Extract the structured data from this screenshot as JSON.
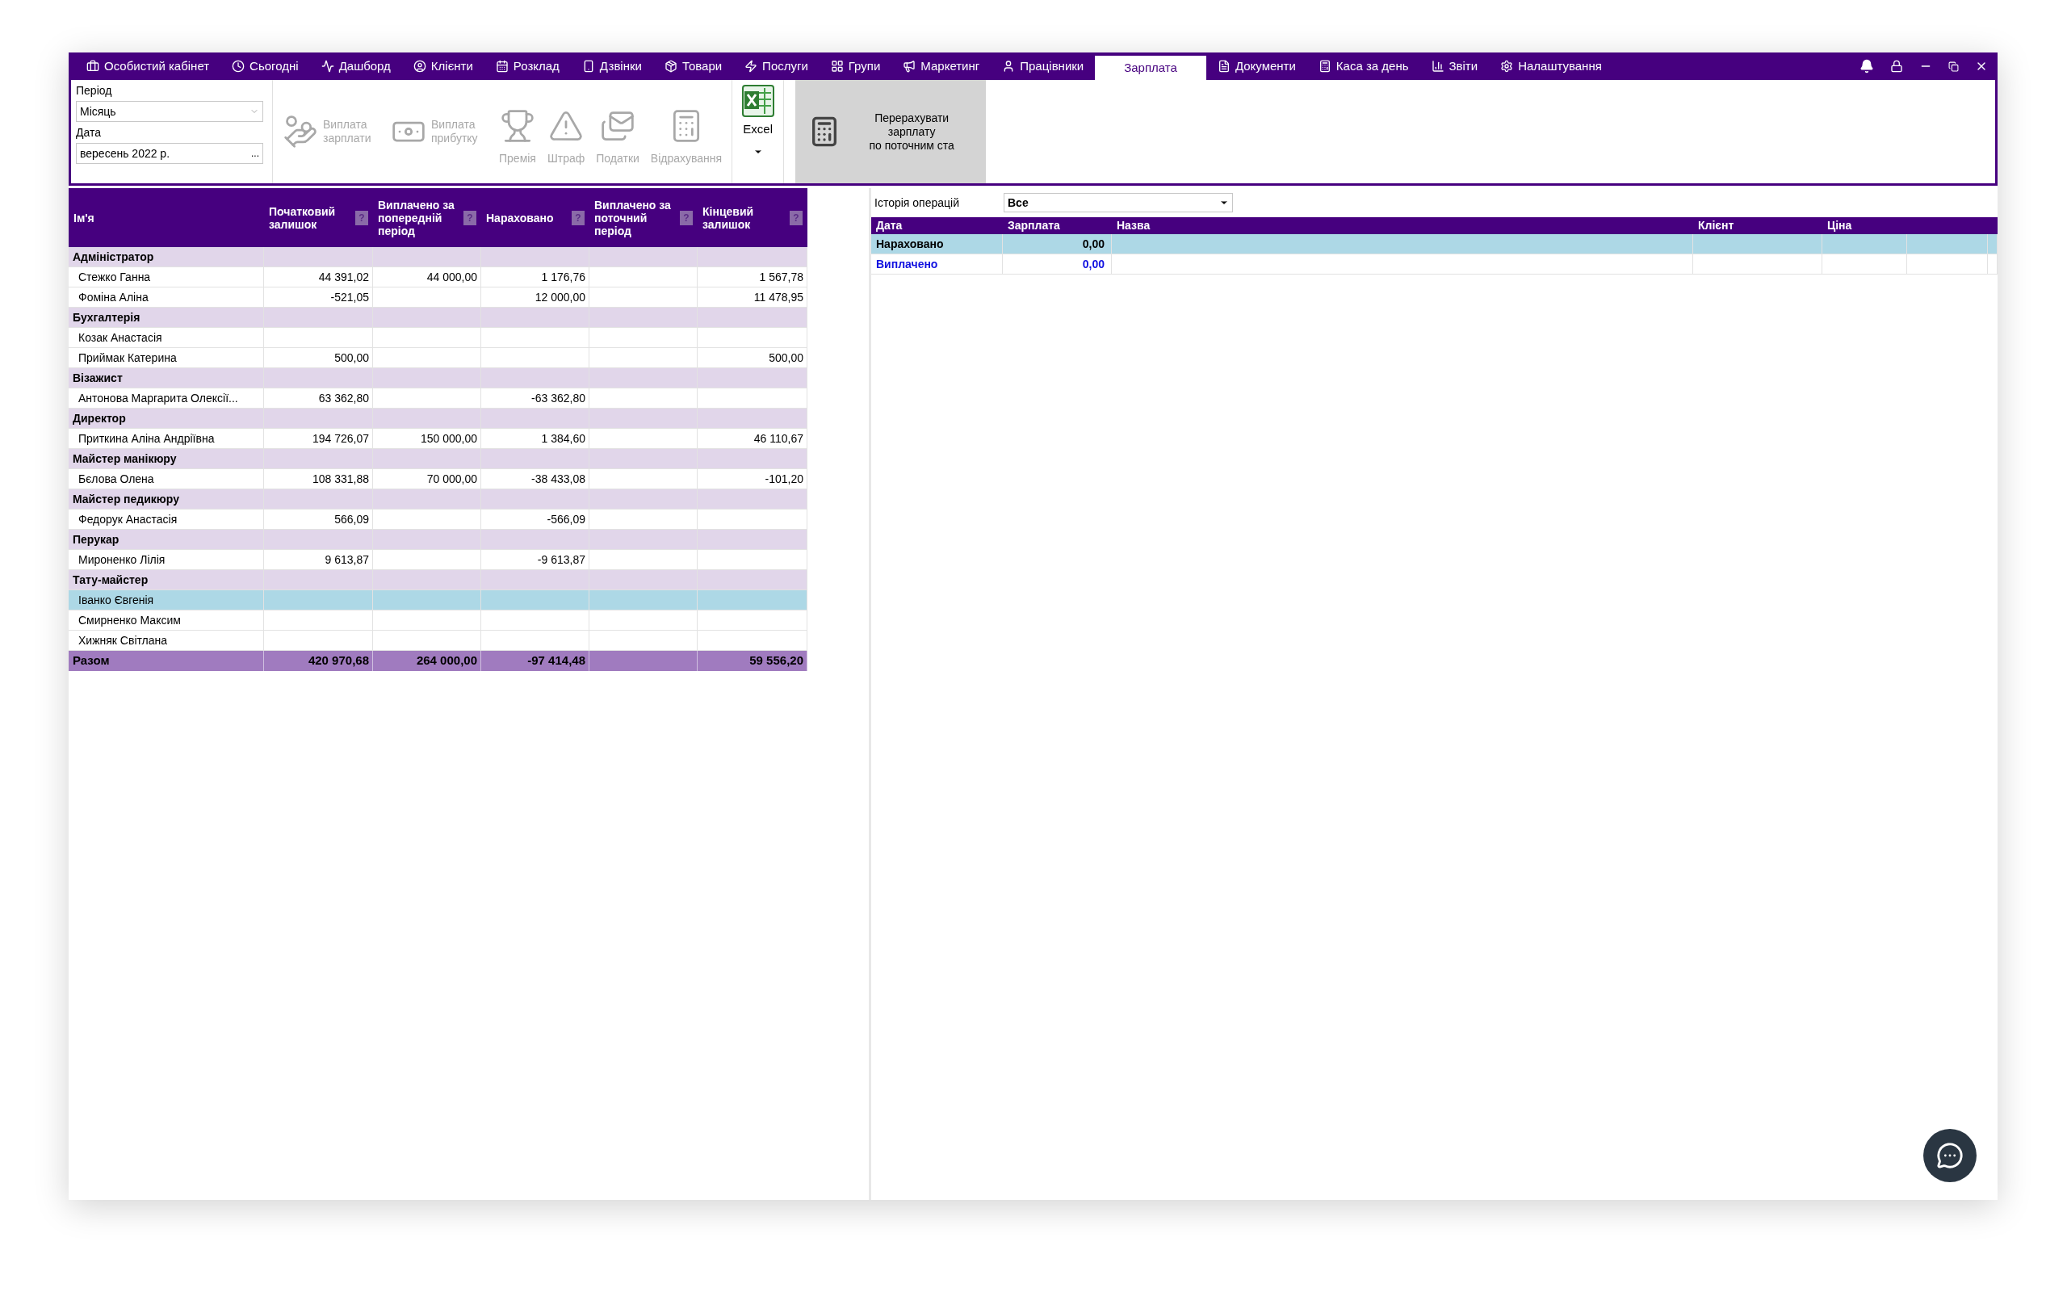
{
  "nav": {
    "tabs": [
      {
        "label": "Особистий кабінет",
        "selected": false
      },
      {
        "label": "Сьогодні",
        "selected": false
      },
      {
        "label": "Дашборд",
        "selected": false
      },
      {
        "label": "Клієнти",
        "selected": false
      },
      {
        "label": "Розклад",
        "selected": false
      },
      {
        "label": "Дзвінки",
        "selected": false
      },
      {
        "label": "Товари",
        "selected": false
      },
      {
        "label": "Послуги",
        "selected": false
      },
      {
        "label": "Групи",
        "selected": false
      },
      {
        "label": "Маркетинг",
        "selected": false
      },
      {
        "label": "Працівники",
        "selected": false
      },
      {
        "label": "Зарплата",
        "selected": true
      },
      {
        "label": "Документи",
        "selected": false
      },
      {
        "label": "Каса за день",
        "selected": false
      },
      {
        "label": "Звіти",
        "selected": false
      },
      {
        "label": "Налаштування",
        "selected": false
      }
    ]
  },
  "toolbar": {
    "period_label": "Період",
    "period_value": "Місяць",
    "date_label": "Дата",
    "date_value": "вересень 2022 р.",
    "date_button": "...",
    "buttons": [
      {
        "label": "Виплата зарплати",
        "disabled": true
      },
      {
        "label": "Виплата прибутку",
        "disabled": true
      },
      {
        "label": "Премія",
        "disabled": true
      },
      {
        "label": "Штраф",
        "disabled": true
      },
      {
        "label": "Податки",
        "disabled": true
      },
      {
        "label": "Відрахування",
        "disabled": true
      }
    ],
    "excel": {
      "label": "Excel",
      "disabled": false
    },
    "recalc": {
      "lines": [
        "Перерахувати зарплату",
        "по поточним ста"
      ]
    }
  },
  "salary_table": {
    "name_column": "Ім'я",
    "columns": [
      {
        "label": "Початковий залишок",
        "hint": "?"
      },
      {
        "label": "Виплачено за попередній період",
        "hint": "?"
      },
      {
        "label": "Нараховано",
        "hint": "?"
      },
      {
        "label": "Виплачено за поточний період",
        "hint": "?"
      },
      {
        "label": "Кінцевий залишок",
        "hint": "?"
      }
    ],
    "groups": [
      {
        "name": "Адміністратор",
        "rows": [
          {
            "name": "Стежко Ганна",
            "cells": [
              "44 391,02",
              "44 000,00",
              "1 176,76",
              "",
              "1 567,78"
            ],
            "selected": false
          },
          {
            "name": "Фоміна Аліна",
            "cells": [
              "-521,05",
              "",
              "12 000,00",
              "",
              "11 478,95"
            ],
            "selected": false
          }
        ]
      },
      {
        "name": "Бухгалтерія",
        "rows": [
          {
            "name": "Козак Анастасія",
            "cells": [
              "",
              "",
              "",
              "",
              ""
            ],
            "selected": false
          },
          {
            "name": "Приймак Катерина",
            "cells": [
              "500,00",
              "",
              "",
              "",
              "500,00"
            ],
            "selected": false
          }
        ]
      },
      {
        "name": "Візажист",
        "rows": [
          {
            "name": "Антонова Маргарита Олексії...",
            "cells": [
              "63 362,80",
              "",
              "-63 362,80",
              "",
              ""
            ],
            "selected": false
          }
        ]
      },
      {
        "name": "Директор",
        "rows": [
          {
            "name": "Приткина Аліна Андріївна",
            "cells": [
              "194 726,07",
              "150 000,00",
              "1 384,60",
              "",
              "46 110,67"
            ],
            "selected": false
          }
        ]
      },
      {
        "name": "Майстер манікюру",
        "rows": [
          {
            "name": "Бєлова Олена",
            "cells": [
              "108 331,88",
              "70 000,00",
              "-38 433,08",
              "",
              "-101,20"
            ],
            "selected": false
          }
        ]
      },
      {
        "name": "Майстер педикюру",
        "rows": [
          {
            "name": "Федорук Анастасія",
            "cells": [
              "566,09",
              "",
              "-566,09",
              "",
              ""
            ],
            "selected": false
          }
        ]
      },
      {
        "name": "Перукар",
        "rows": [
          {
            "name": "Мироненко Лілія",
            "cells": [
              "9 613,87",
              "",
              "-9 613,87",
              "",
              ""
            ],
            "selected": false
          }
        ]
      },
      {
        "name": "Тату-майстер",
        "rows": [
          {
            "name": "Іванко Євгенія",
            "cells": [
              "",
              "",
              "",
              "",
              ""
            ],
            "selected": true
          },
          {
            "name": "Смирненко Максим",
            "cells": [
              "",
              "",
              "",
              "",
              ""
            ],
            "selected": false
          },
          {
            "name": "Хижняк Світлана",
            "cells": [
              "",
              "",
              "",
              "",
              ""
            ],
            "selected": false
          }
        ]
      }
    ],
    "total": {
      "label": "Разом",
      "cells": [
        "420 970,68",
        "264 000,00",
        "-97 414,48",
        "",
        "59 556,20"
      ]
    }
  },
  "history": {
    "label": "Історія операцій",
    "filter_value": "Все",
    "columns": [
      "Дата",
      "Зарплата",
      "Назва",
      "Клієнт",
      "Ціна"
    ],
    "rows": [
      {
        "kind": "accrued",
        "label": "Нараховано",
        "amount": "0,00",
        "selected": true
      },
      {
        "kind": "paid",
        "label": "Виплачено",
        "amount": "0,00",
        "selected": false
      }
    ]
  }
}
